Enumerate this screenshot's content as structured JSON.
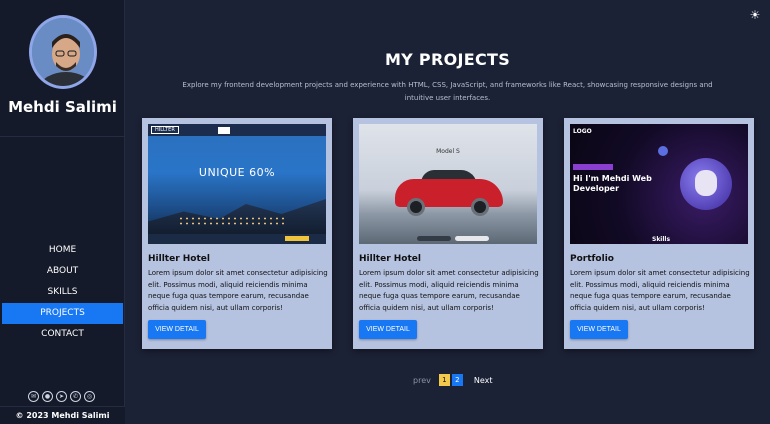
{
  "sidebar": {
    "name": "Mehdi Salimi",
    "nav": [
      {
        "label": "HOME",
        "active": false
      },
      {
        "label": "ABOUT",
        "active": false
      },
      {
        "label": "SKILLS",
        "active": false
      },
      {
        "label": "PROJECTS",
        "active": true
      },
      {
        "label": "CONTACT",
        "active": false
      }
    ],
    "socials": [
      "mail-icon",
      "github-icon",
      "telegram-icon",
      "whatsapp-icon",
      "instagram-icon"
    ],
    "copyright": "© 2023 Mehdi Salimi"
  },
  "header": {
    "theme_toggle_icon": "sun-icon"
  },
  "main": {
    "title": "MY PROJECTS",
    "intro": "Explore my frontend development projects and experience with HTML, CSS, JavaScript, and frameworks like React, showcasing responsive designs and intuitive user interfaces.",
    "projects": [
      {
        "title": "Hillter Hotel",
        "description": "Lorem ipsum dolor sit amet consectetur adipisicing elit. Possimus modi, aliquid reiciendis minima neque fuga quas tempore earum, recusandae officia quidem nisi, aut ullam corporis!",
        "button": "VIEW DETAIL",
        "thumb": {
          "logo": "HILLTER",
          "headline": "UNIQUE 60%"
        }
      },
      {
        "title": "Hillter Hotel",
        "description": "Lorem ipsum dolor sit amet consectetur adipisicing elit. Possimus modi, aliquid reiciendis minima neque fuga quas tempore earum, recusandae officia quidem nisi, aut ullam corporis!",
        "button": "VIEW DETAIL",
        "thumb": {
          "headline": "Model S"
        }
      },
      {
        "title": "Portfolio",
        "description": "Lorem ipsum dolor sit amet consectetur adipisicing elit. Possimus modi, aliquid reiciendis minima neque fuga quas tempore earum, recusandae officia quidem nisi, aut ullam corporis!",
        "button": "VIEW DETAIL",
        "thumb": {
          "logo": "LOGO",
          "headline": "Hi I'm Mehdi Web Developer",
          "footer": "Skills"
        }
      }
    ]
  },
  "pagination": {
    "prev": "prev",
    "pages": [
      "1",
      "2"
    ],
    "current": "1",
    "next": "Next"
  },
  "colors": {
    "background": "#1c2236",
    "sidebar": "#151a2a",
    "accent": "#1877f2",
    "card": "#b5c2e0",
    "page_highlight": "#f2c94c"
  }
}
